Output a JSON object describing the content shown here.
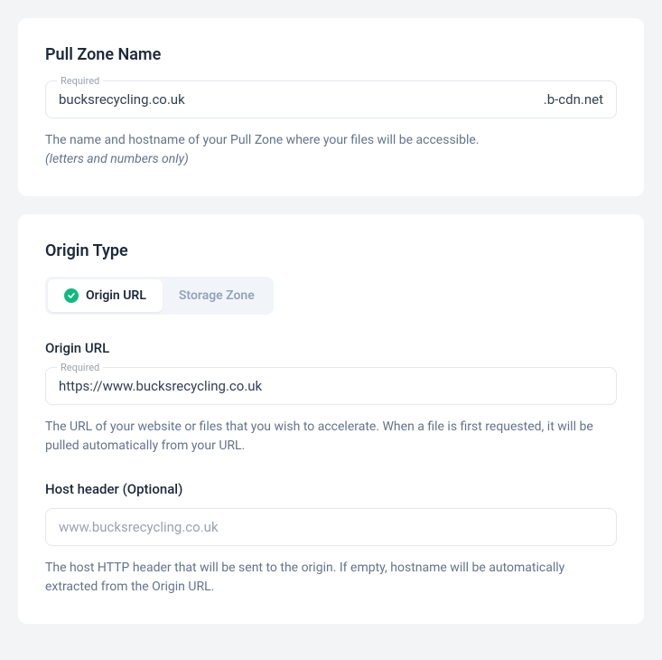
{
  "pullZone": {
    "title": "Pull Zone Name",
    "requiredLabel": "Required",
    "nameValue": "bucksrecycling.co.uk",
    "suffix": ".b-cdn.net",
    "helper": "The name and hostname of your Pull Zone where your files will be accessible.",
    "helperItalic": "(letters and numbers only)"
  },
  "originType": {
    "title": "Origin Type",
    "options": {
      "url": "Origin URL",
      "storage": "Storage Zone"
    }
  },
  "originUrl": {
    "label": "Origin URL",
    "requiredLabel": "Required",
    "value": "https://www.bucksrecycling.co.uk",
    "helper": "The URL of your website or files that you wish to accelerate. When a file is first requested, it will be pulled automatically from your URL."
  },
  "hostHeader": {
    "label": "Host header (Optional)",
    "placeholder": "www.bucksrecycling.co.uk",
    "helper": "The host HTTP header that will be sent to the origin. If empty, hostname will be automatically extracted from the Origin URL."
  }
}
